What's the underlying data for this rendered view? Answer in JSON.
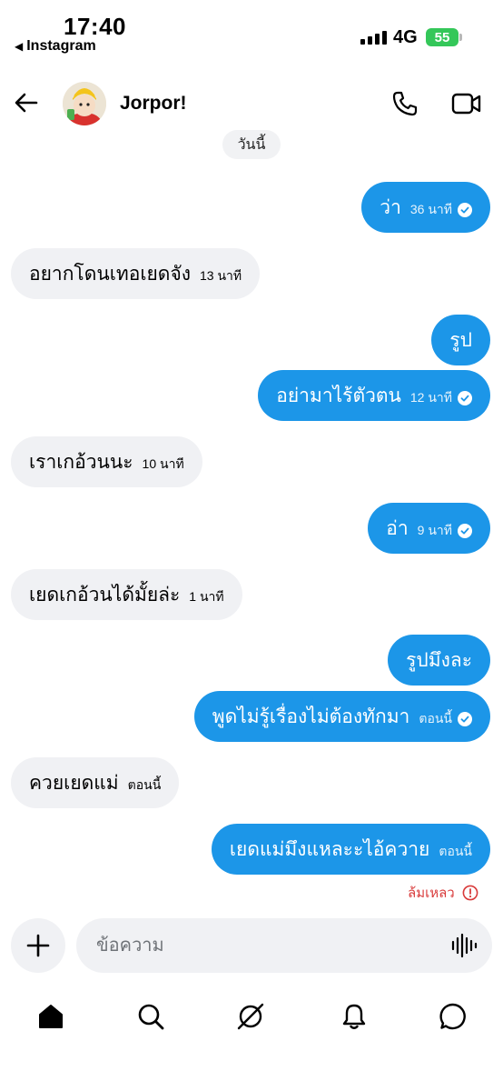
{
  "status_bar": {
    "time": "17:40",
    "back_app": "Instagram",
    "network": "4G",
    "battery": "55"
  },
  "header": {
    "contact_name": "Jorpor!"
  },
  "conversation": {
    "day_label": "วันนี้",
    "messages": [
      {
        "direction": "out",
        "text": "ว่า",
        "time": "36 นาที",
        "seen": true
      },
      {
        "direction": "in",
        "text": "อยากโดนเทอเยดจัง",
        "time": "13 นาที"
      },
      {
        "direction": "out",
        "text": "รูป",
        "time": "",
        "seen": false
      },
      {
        "direction": "out",
        "text": "อย่ามาไร้ตัวตน",
        "time": "12 นาที",
        "seen": true
      },
      {
        "direction": "in",
        "text": "เราเกอ้วนนะ",
        "time": "10 นาที"
      },
      {
        "direction": "out",
        "text": "อ่า",
        "time": "9 นาที",
        "seen": true
      },
      {
        "direction": "in",
        "text": "เยดเกอ้วนได้มั้ยล่ะ",
        "time": "1 นาที"
      },
      {
        "direction": "out",
        "text": "รูปมึงละ",
        "time": "",
        "seen": false
      },
      {
        "direction": "out",
        "text": "พูดไม่รู้เรื่องไม่ต้องทักมา",
        "time": "ตอนนี้",
        "seen": true
      },
      {
        "direction": "in",
        "text": "ควยเยดแม่",
        "time": "ตอนนี้"
      },
      {
        "direction": "out",
        "text": "เยดแม่มึงแหละะไอ้ควาย",
        "time": "ตอนนี้",
        "seen": false
      }
    ],
    "failed_label": "ล้มเหลว"
  },
  "composer": {
    "placeholder": "ข้อความ"
  },
  "colors": {
    "outgoing_bubble": "#1c96e8",
    "incoming_bubble": "#f0f1f4",
    "failed": "#d93b3b",
    "battery": "#34c759"
  },
  "icons": {
    "back": "arrow-left-icon",
    "call": "phone-icon",
    "video": "video-camera-icon",
    "plus": "plus-icon",
    "voice": "waveform-icon",
    "nav": [
      "home-icon",
      "search-icon",
      "explore-icon",
      "bell-icon",
      "chat-icon"
    ]
  }
}
